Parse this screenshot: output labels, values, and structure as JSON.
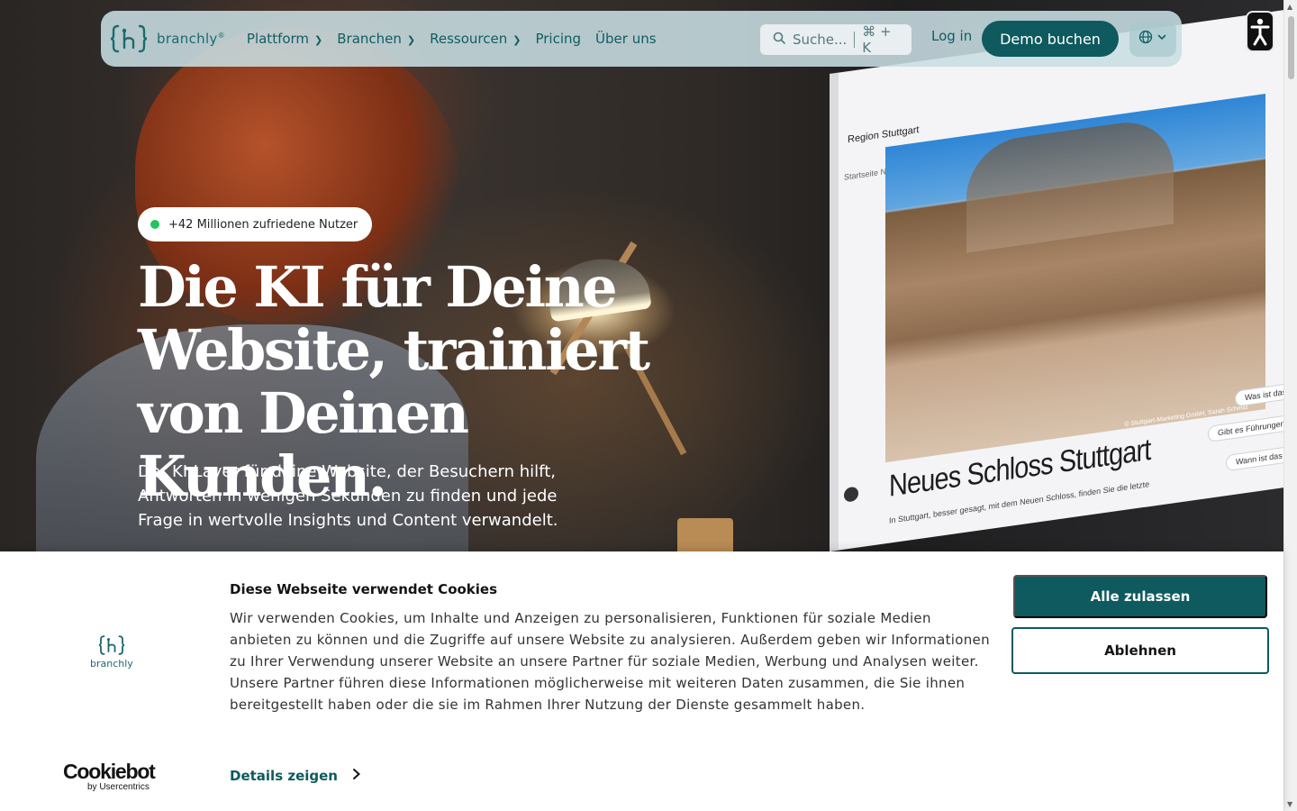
{
  "brand": {
    "name": "branchly",
    "mark": "®"
  },
  "nav": {
    "items": [
      {
        "label": "Plattform",
        "has_dropdown": true
      },
      {
        "label": "Branchen",
        "has_dropdown": true
      },
      {
        "label": "Ressourcen",
        "has_dropdown": true
      },
      {
        "label": "Pricing",
        "has_dropdown": false
      },
      {
        "label": "Über uns",
        "has_dropdown": false
      }
    ],
    "search_placeholder": "Suche...",
    "search_shortcut": "⌘ + K",
    "login_label": "Log in",
    "demo_label": "Demo buchen",
    "language_icon": "globe-icon"
  },
  "hero": {
    "badge": "+42 Millionen zufriedene Nutzer",
    "headline": "Die KI für Deine Website, trainiert von Deinen Kunden.",
    "subline": "Der KI-Layer für deine Website, der Besuchern hilft, Antworten in wenigen Sekunden zu finden und jede Frage in wertvolle Insights und Content verwandelt."
  },
  "monitor": {
    "site_logo": "Region Stuttgart",
    "breadcrumb": "Startseite   Neues Schloss Stuttgart",
    "photo_caption": "© Stuttgart-Marketing GmbH, Sarah Schmid",
    "title": "Neues Schloss Stuttgart",
    "text": "In Stuttgart, besser gesagt, mit dem Neuen Schloss, finden Sie die letzte",
    "chips": [
      "Was ist das Röm",
      "Gibt es Führungen durch d",
      "Wann ist das Neue S"
    ]
  },
  "cookie": {
    "brand_name": "branchly",
    "title": "Diese Webseite verwendet Cookies",
    "text": "Wir verwenden Cookies, um Inhalte und Anzeigen zu personalisieren, Funktionen für soziale Medien anbieten zu können und die Zugriffe auf unsere Website zu analysieren. Außerdem geben wir Informationen zu Ihrer Verwendung unserer Website an unsere Partner für soziale Medien, Werbung und Analysen weiter. Unsere Partner führen diese Informationen möglicherweise mit weiteren Daten zusammen, die Sie ihnen bereitgestellt haben oder die sie im Rahmen Ihrer Nutzung der Dienste gesammelt haben.",
    "details_label": "Details zeigen",
    "accept_label": "Alle zulassen",
    "decline_label": "Ablehnen",
    "provider_name": "Cookiebot",
    "provider_sub": "by Usercentrics"
  },
  "colors": {
    "brand": "#0e5a5e",
    "nav_bg": "#c8dee2",
    "status_dot": "#22c55e"
  }
}
